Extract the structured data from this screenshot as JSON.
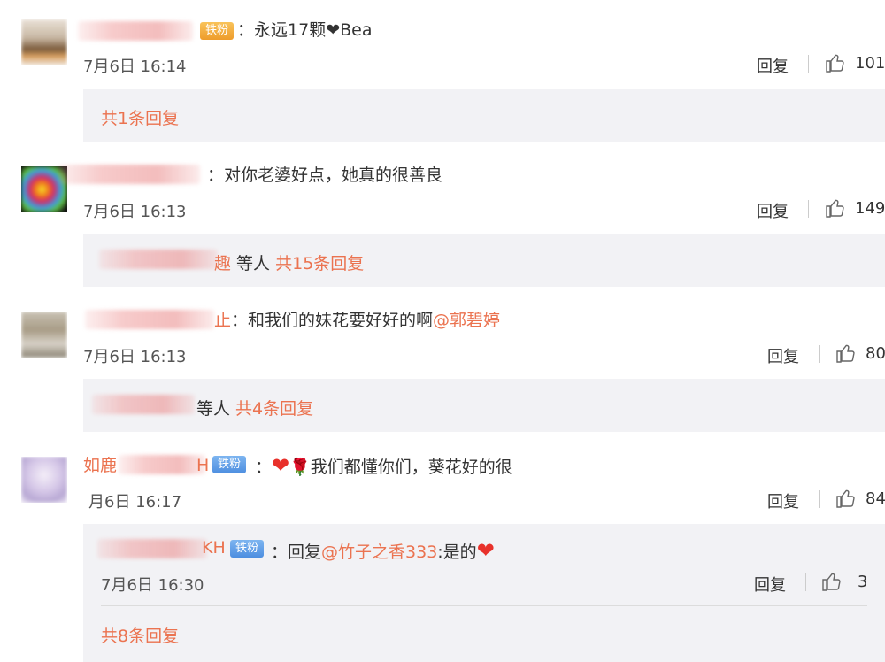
{
  "colors": {
    "link": "#eb7350",
    "reply_bg": "#f2f2f5",
    "badge_gold": "#ee9c2b",
    "badge_blue": "#4d8ee0"
  },
  "comments": [
    {
      "badge": "铁粉",
      "text": "：永远17颗",
      "text_suffix": "Bea",
      "time": "7月6日 16:14",
      "reply_label": "回复",
      "likes": "101",
      "more": "共1条回复"
    },
    {
      "text": "：对你老婆好点，她真的很善良",
      "time": "7月6日 16:13",
      "reply_label": "回复",
      "likes": "149",
      "more_prefix": "趣",
      "more_mid": " 等人 ",
      "more": "共15条回复"
    },
    {
      "name_tail": "止",
      "text": "：和我们的妹花要好好的啊",
      "mention": "@郭碧婷",
      "time": "7月6日 16:13",
      "reply_label": "回复",
      "likes": "80",
      "more_prefix": "",
      "more_mid": "等人 ",
      "more": "共4条回复"
    },
    {
      "name_head": "如鹿",
      "name_tail": "H",
      "badge": "铁粉",
      "text": "：",
      "text_after_emoji": "我们都懂你们，葵花好的很",
      "time": "月6日 16:17",
      "reply_label": "回复",
      "likes": "84",
      "sub_reply": {
        "name_tail": "KH",
        "badge": "铁粉",
        "text": "：回复",
        "mention": "@竹子之香333",
        "text_after": ":是的",
        "time": "7月6日 16:30",
        "reply_label": "回复",
        "likes": "3"
      },
      "more": "共8条回复"
    }
  ]
}
